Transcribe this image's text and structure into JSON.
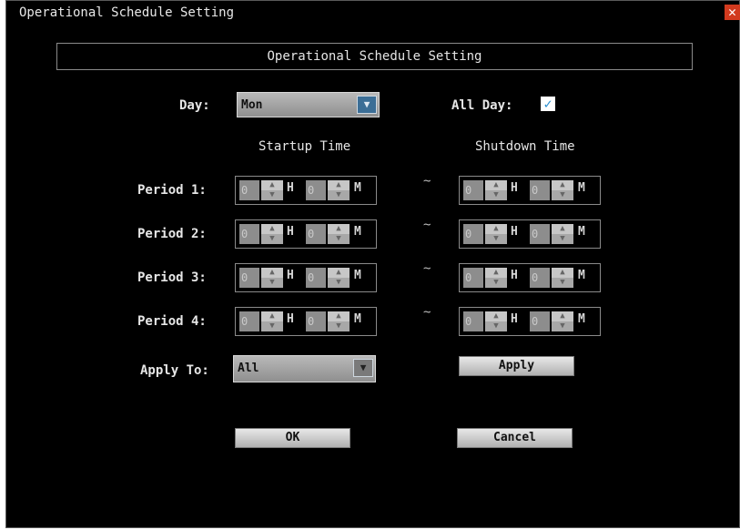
{
  "window": {
    "title": "Operational Schedule Setting",
    "close_glyph": "✕"
  },
  "header": {
    "title": "Operational Schedule Setting"
  },
  "day": {
    "label": "Day:",
    "value": "Mon"
  },
  "all_day": {
    "label": "All Day:",
    "checked": true,
    "mark": "✓"
  },
  "columns": {
    "startup": "Startup Time",
    "shutdown": "Shutdown Time"
  },
  "periods": [
    {
      "label": "Period 1:",
      "start_h": "0",
      "start_m": "0",
      "end_h": "0",
      "end_m": "0"
    },
    {
      "label": "Period 2:",
      "start_h": "0",
      "start_m": "0",
      "end_h": "0",
      "end_m": "0"
    },
    {
      "label": "Period 3:",
      "start_h": "0",
      "start_m": "0",
      "end_h": "0",
      "end_m": "0"
    },
    {
      "label": "Period 4:",
      "start_h": "0",
      "start_m": "0",
      "end_h": "0",
      "end_m": "0"
    }
  ],
  "units": {
    "hour": "H",
    "minute": "M"
  },
  "separator": "~",
  "apply_to": {
    "label": "Apply To:",
    "value": "All"
  },
  "buttons": {
    "apply": "Apply",
    "ok": "OK",
    "cancel": "Cancel"
  },
  "glyphs": {
    "arrow_down": "▼",
    "spin_up": "▲",
    "spin_down": "▼"
  },
  "colors": {
    "background": "#000000",
    "accent_select": "#3b6e96",
    "close": "#d23a1e"
  }
}
